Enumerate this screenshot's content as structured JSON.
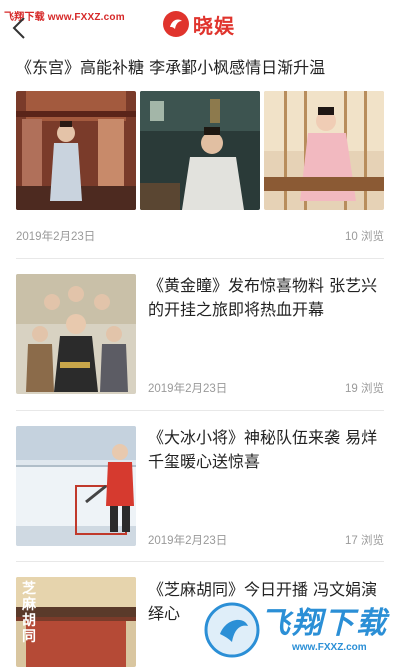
{
  "watermark_top": "飞翔下载 www.FXXZ.com",
  "header": {
    "logo_text": "晓娱"
  },
  "featured": {
    "title": "《东宫》高能补糖 李承鄞小枫感情日渐升温",
    "date": "2019年2月23日",
    "views": "10 浏览"
  },
  "items": [
    {
      "title": "《黄金瞳》发布惊喜物料 张艺兴的开挂之旅即将热血开幕",
      "date": "2019年2月23日",
      "views": "19 浏览"
    },
    {
      "title": "《大冰小将》神秘队伍来袭 易烊千玺暖心送惊喜",
      "date": "2019年2月23日",
      "views": "17 浏览"
    },
    {
      "title": "《芝麻胡同》今日开播 冯文娟演绎心",
      "thumb_text": "芝麻胡同"
    }
  ],
  "watermark_bottom": {
    "text": "飞翔下载",
    "url": "www.FXXZ.com"
  },
  "colors": {
    "brand": "#e0342d",
    "meta": "#9a9a9a",
    "divider": "#e8e8e8",
    "watermark": "#2b8fd6"
  }
}
